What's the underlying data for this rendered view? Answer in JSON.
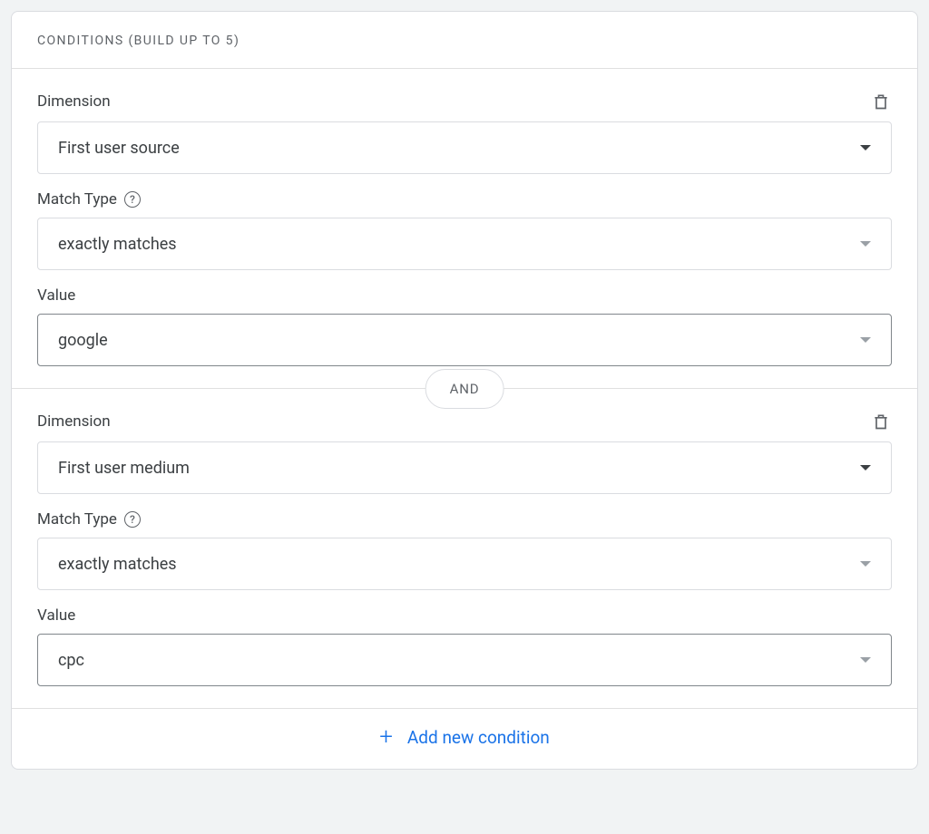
{
  "header": {
    "title": "CONDITIONS (BUILD UP TO 5)"
  },
  "labels": {
    "dimension": "Dimension",
    "match_type": "Match Type",
    "value": "Value"
  },
  "joiner": "AND",
  "conditions": [
    {
      "dimension": "First user source",
      "match_type": "exactly matches",
      "value": "google"
    },
    {
      "dimension": "First user medium",
      "match_type": "exactly matches",
      "value": "cpc"
    }
  ],
  "footer": {
    "add_label": "Add new condition"
  }
}
